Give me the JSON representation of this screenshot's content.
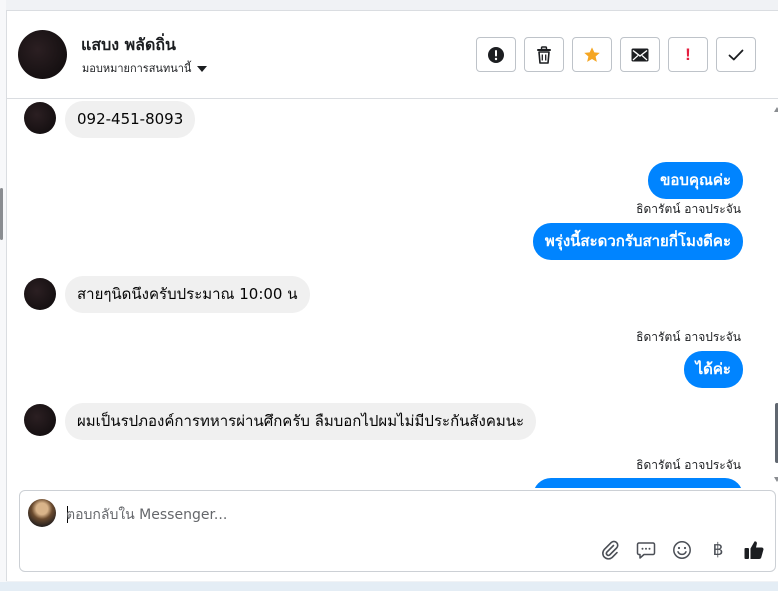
{
  "header": {
    "contact_name": "แสบง พลัดถิ่น",
    "assign_label": "มอบหมายการสนทนานี้",
    "actions": [
      {
        "name": "report-spam-button",
        "icon": "exclamation-circle-icon"
      },
      {
        "name": "delete-button",
        "icon": "trash-icon"
      },
      {
        "name": "star-button",
        "icon": "star-icon",
        "color": "#f5a623"
      },
      {
        "name": "mark-unread-button",
        "icon": "envelope-icon"
      },
      {
        "name": "follow-up-button",
        "icon": "exclamation-icon",
        "glyph": "!",
        "color": "#e41e3f"
      },
      {
        "name": "mark-done-button",
        "icon": "check-icon"
      }
    ]
  },
  "messages": {
    "m1": {
      "text": "092-451-8093"
    },
    "m2": {
      "text": "ขอบคุณค่ะ"
    },
    "m3": {
      "sender": "ธิดารัตน์ อาจประจัน",
      "text": "พรุ่งนี้สะดวกรับสายกี่โมงดีคะ"
    },
    "m4": {
      "text": "สายๆนิดนึงครับประมาณ 10:00 น"
    },
    "m5": {
      "sender": "ธิดารัตน์ อาจประจัน",
      "text": "ได้ค่ะ"
    },
    "m6": {
      "text": "ผมเป็นรปภองค์การทหารผ่านศึกครับ ลืมบอกไปผมไม่มีประกันสังคมนะ"
    },
    "m7": {
      "sender": "ธิดารัตน์ อาจประจัน",
      "text": ""
    }
  },
  "colors": {
    "outgoing_bubble": "#0084ff",
    "incoming_bubble": "#f0f0f0"
  },
  "composer": {
    "placeholder": "ตอบกลับใน Messenger...",
    "value": "",
    "tools": [
      {
        "name": "attach-icon"
      },
      {
        "name": "saved-replies-icon"
      },
      {
        "name": "emoji-icon"
      },
      {
        "name": "baht-icon",
        "glyph": "฿"
      },
      {
        "name": "like-icon"
      }
    ]
  }
}
